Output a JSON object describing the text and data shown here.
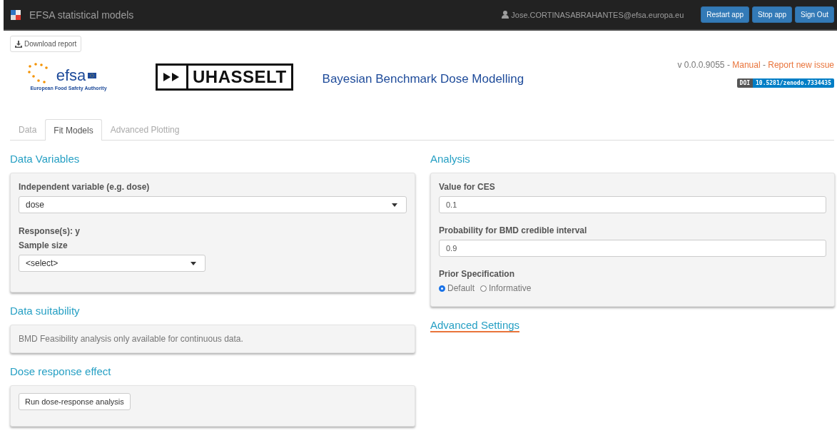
{
  "navbar": {
    "title": "EFSA statistical models",
    "user": "Jose.CORTINASABRAHANTES@efsa.europa.eu",
    "buttons": [
      "Restart app",
      "Stop app",
      "Sign Out"
    ]
  },
  "header": {
    "download_button": "Download report",
    "efsa_logo": {
      "name": "efsa",
      "subtitle": "European Food Safety Authority"
    },
    "uhasselt_logo": {
      "text": "UHASSELT"
    },
    "title": "Bayesian Benchmark Dose Modelling",
    "version": "v 0.0.0.9055",
    "separator": "-",
    "links": [
      "Manual",
      "Report new issue"
    ],
    "doi": {
      "label": "DOI",
      "value": "10.5281/zenodo.7334435"
    }
  },
  "tabs": [
    {
      "label": "Data",
      "selected": false
    },
    {
      "label": "Fit Models",
      "selected": true
    },
    {
      "label": "Advanced Plotting",
      "selected": false
    }
  ],
  "data_variables": {
    "heading": "Data Variables",
    "independent_label": "Independent variable (e.g. dose)",
    "independent_value": "dose",
    "response": "Response(s): y",
    "sample_size_label": "Sample size",
    "sample_size_value": "<select>"
  },
  "data_suitability": {
    "heading": "Data suitability",
    "message": "BMD Feasibility analysis only available for continuous data."
  },
  "dose_response": {
    "heading": "Dose response effect",
    "button": "Run dose-response analysis"
  },
  "analysis": {
    "heading": "Analysis",
    "fields": [
      {
        "label": "Value for CES",
        "value": "0.1"
      },
      {
        "label": "Probability for BMD credible interval",
        "value": "0.9"
      }
    ],
    "prior_label": "Prior Specification",
    "prior_options": [
      {
        "label": "Default",
        "selected": true
      },
      {
        "label": "Informative",
        "selected": false
      }
    ],
    "advanced_link": "Advanced Settings"
  }
}
